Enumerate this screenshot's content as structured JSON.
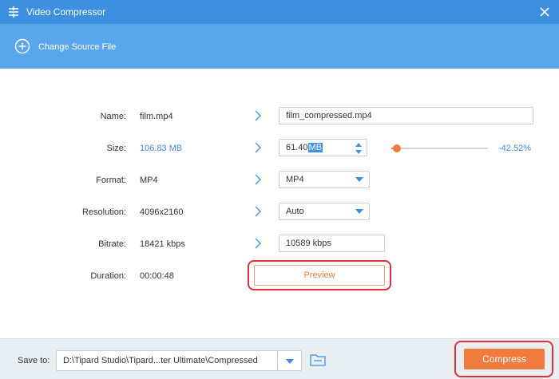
{
  "window": {
    "title": "Video Compressor"
  },
  "toolbar": {
    "change_source_label": "Change Source File"
  },
  "rows": {
    "name": {
      "label": "Name:",
      "original": "film.mp4",
      "output": "film_compressed.mp4"
    },
    "size": {
      "label": "Size:",
      "original": "106.83 MB",
      "output_number": "61.40",
      "output_unit": "MB",
      "reduction_percent": "-42.52%",
      "slider_fraction": 0.06
    },
    "format": {
      "label": "Format:",
      "original": "MP4",
      "output": "MP4"
    },
    "resolution": {
      "label": "Resolution:",
      "original": "4096x2160",
      "output": "Auto"
    },
    "bitrate": {
      "label": "Bitrate:",
      "original": "18421 kbps",
      "output": "10589 kbps"
    },
    "duration": {
      "label": "Duration:",
      "original": "00:00:48"
    }
  },
  "preview_label": "Preview",
  "footer": {
    "save_to_label": "Save to:",
    "save_path": "D:\\Tipard Studio\\Tipard...ter Ultimate\\Compressed",
    "compress_label": "Compress"
  },
  "colors": {
    "accent": "#3d8fe0",
    "orange": "#f07b3f",
    "highlight_ring": "#e0303a"
  },
  "icons": [
    "app-icon",
    "close-icon",
    "add-circle-icon",
    "chevron-right-icon",
    "dropdown-arrow-icon",
    "spin-up-icon",
    "spin-down-icon",
    "folder-icon"
  ]
}
